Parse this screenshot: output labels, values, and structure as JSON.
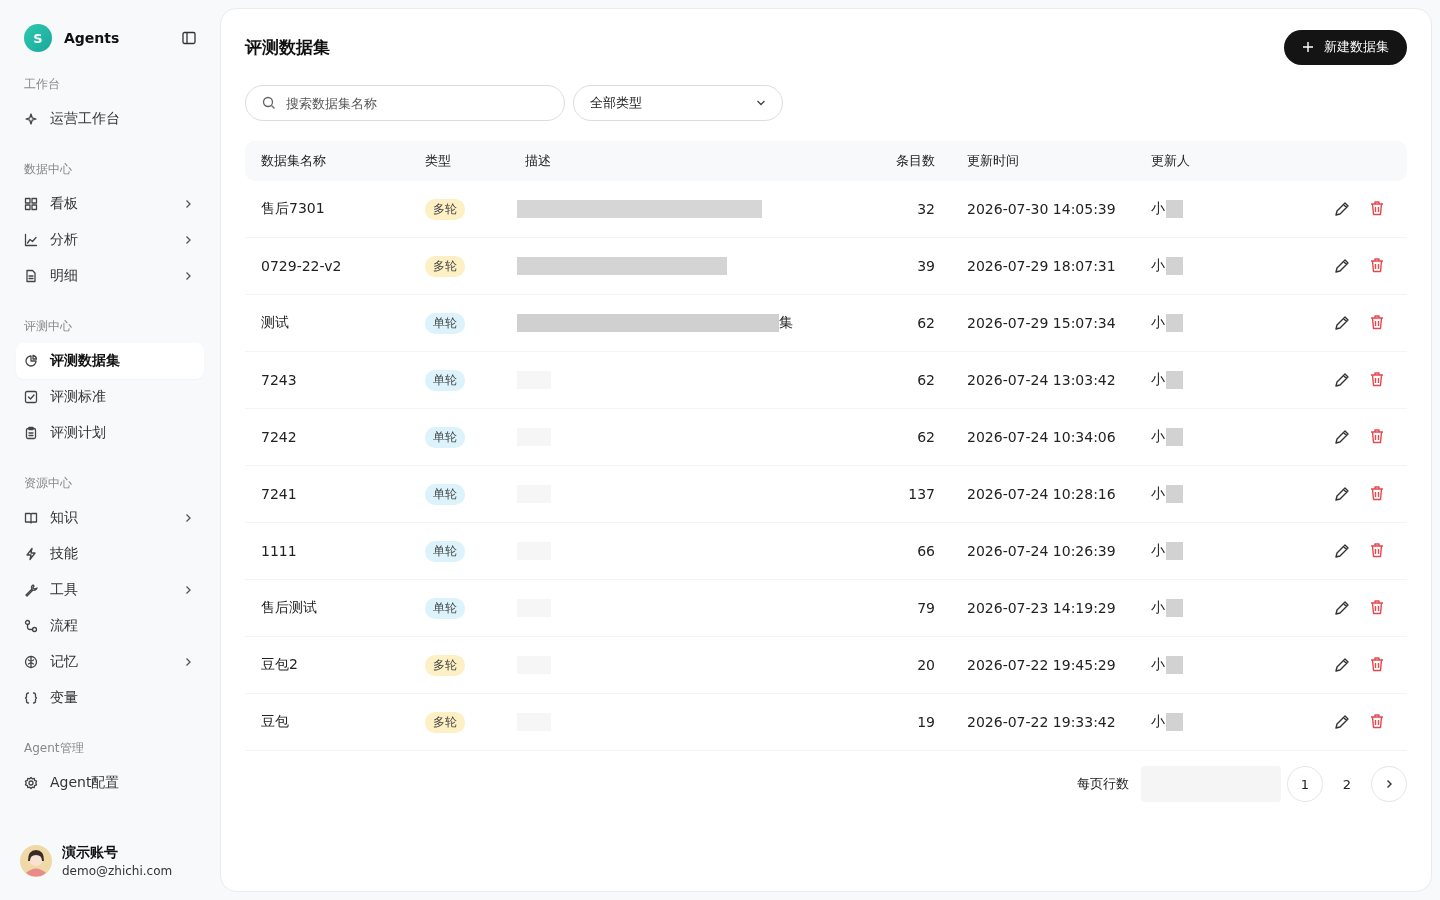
{
  "sidebar": {
    "brand": {
      "initial": "S",
      "name": "Agents"
    },
    "sections": [
      {
        "heading": "工作台",
        "items": [
          {
            "label": "运营工作台",
            "expandable": false,
            "selected": false
          }
        ]
      },
      {
        "heading": "数据中心",
        "items": [
          {
            "label": "看板",
            "expandable": true,
            "selected": false
          },
          {
            "label": "分析",
            "expandable": true,
            "selected": false
          },
          {
            "label": "明细",
            "expandable": true,
            "selected": false
          }
        ]
      },
      {
        "heading": "评测中心",
        "items": [
          {
            "label": "评测数据集",
            "expandable": false,
            "selected": true
          },
          {
            "label": "评测标准",
            "expandable": false,
            "selected": false
          },
          {
            "label": "评测计划",
            "expandable": false,
            "selected": false
          }
        ]
      },
      {
        "heading": "资源中心",
        "items": [
          {
            "label": "知识",
            "expandable": true,
            "selected": false
          },
          {
            "label": "技能",
            "expandable": false,
            "selected": false
          },
          {
            "label": "工具",
            "expandable": true,
            "selected": false
          },
          {
            "label": "流程",
            "expandable": false,
            "selected": false
          },
          {
            "label": "记忆",
            "expandable": true,
            "selected": false
          },
          {
            "label": "变量",
            "expandable": false,
            "selected": false
          }
        ]
      },
      {
        "heading": "Agent管理",
        "items": [
          {
            "label": "Agent配置",
            "expandable": false,
            "selected": false
          }
        ]
      }
    ],
    "user": {
      "name": "演示账号",
      "email": "demo@zhichi.com"
    }
  },
  "page": {
    "title": "评测数据集",
    "new_button": "新建数据集"
  },
  "filters": {
    "search": {
      "placeholder": "搜索数据集名称"
    },
    "type_select": {
      "value": "全部类型"
    }
  },
  "table": {
    "columns": [
      "数据集名称",
      "类型",
      "描述",
      "条目数",
      "更新时间",
      "更新人"
    ],
    "rows": [
      {
        "name": "售后7301",
        "tag": {
          "label": "多轮",
          "color": "#fdf0c4"
        },
        "description": {
          "kind": "long"
        },
        "count": "32",
        "updated": "2026-07-30 14:05:39",
        "updater": "小"
      },
      {
        "name": "0729-22-v2",
        "tag": {
          "label": "多轮",
          "color": "#fdf0c4"
        },
        "description": {
          "kind": "medium"
        },
        "count": "39",
        "updated": "2026-07-29 18:07:31",
        "updater": "小"
      },
      {
        "name": "测试",
        "tag": {
          "label": "单轮",
          "color": "#ddf3fb"
        },
        "description": {
          "kind": "full",
          "tail": "集"
        },
        "count": "62",
        "updated": "2026-07-29 15:07:34",
        "updater": "小"
      },
      {
        "name": "7243",
        "tag": {
          "label": "单轮",
          "color": "#ddf3fb"
        },
        "description": {
          "kind": "faint"
        },
        "count": "62",
        "updated": "2026-07-24 13:03:42",
        "updater": "小"
      },
      {
        "name": "7242",
        "tag": {
          "label": "单轮",
          "color": "#ddf3fb"
        },
        "description": {
          "kind": "faint"
        },
        "count": "62",
        "updated": "2026-07-24 10:34:06",
        "updater": "小"
      },
      {
        "name": "7241",
        "tag": {
          "label": "单轮",
          "color": "#ddf3fb"
        },
        "description": {
          "kind": "faint"
        },
        "count": "137",
        "updated": "2026-07-24 10:28:16",
        "updater": "小"
      },
      {
        "name": "1111",
        "tag": {
          "label": "单轮",
          "color": "#ddf3fb"
        },
        "description": {
          "kind": "faint"
        },
        "count": "66",
        "updated": "2026-07-24 10:26:39",
        "updater": "小"
      },
      {
        "name": "售后测试",
        "tag": {
          "label": "单轮",
          "color": "#ddf3fb"
        },
        "description": {
          "kind": "faint"
        },
        "count": "79",
        "updated": "2026-07-23 14:19:29",
        "updater": "小"
      },
      {
        "name": "豆包2",
        "tag": {
          "label": "多轮",
          "color": "#fdf0c4"
        },
        "description": {
          "kind": "faint"
        },
        "count": "20",
        "updated": "2026-07-22 19:45:29",
        "updater": "小"
      },
      {
        "name": "豆包",
        "tag": {
          "label": "多轮",
          "color": "#fdf0c4"
        },
        "description": {
          "kind": "faint"
        },
        "count": "19",
        "updated": "2026-07-22 19:33:42",
        "updater": "小"
      }
    ]
  },
  "pagination": {
    "rows_per_page_label": "每页行数",
    "pages": [
      {
        "label": "1",
        "selected": true
      },
      {
        "label": "2",
        "selected": false
      }
    ]
  }
}
